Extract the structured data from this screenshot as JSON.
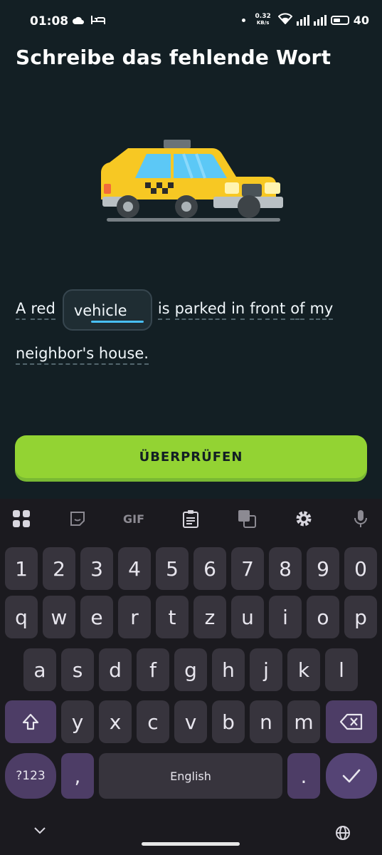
{
  "status_bar": {
    "time": "01:08",
    "speed_value": "0.32",
    "speed_unit": "KB/s",
    "battery_level": "40",
    "icons": [
      "cloud-icon",
      "bed-icon",
      "wifi-icon",
      "signal-icon",
      "signal-icon",
      "battery-icon"
    ]
  },
  "exercise": {
    "title": "Schreibe das fehlende Wort",
    "image": "taxi-illustration",
    "sentence_words_before": [
      "A",
      "red"
    ],
    "blank_value": "vehicle",
    "sentence_words_after_line1": [
      "is",
      "parked",
      "in",
      "front",
      "of",
      "my"
    ],
    "sentence_line2": "neighbor's house.",
    "check_button": "ÜBERPRÜFEN"
  },
  "keyboard": {
    "toolbar": [
      "apps-icon",
      "sticker-icon",
      "gif-label",
      "clipboard-icon",
      "translate-icon",
      "settings-icon",
      "mic-icon"
    ],
    "gif_label": "GIF",
    "row_numbers": [
      "1",
      "2",
      "3",
      "4",
      "5",
      "6",
      "7",
      "8",
      "9",
      "0"
    ],
    "row1": [
      "q",
      "w",
      "e",
      "r",
      "t",
      "z",
      "u",
      "i",
      "o",
      "p"
    ],
    "row2": [
      "a",
      "s",
      "d",
      "f",
      "g",
      "h",
      "j",
      "k",
      "l"
    ],
    "row3": [
      "y",
      "x",
      "c",
      "v",
      "b",
      "n",
      "m"
    ],
    "symbols_key": "?123",
    "comma_key": ",",
    "space_label": "English",
    "period_key": ".",
    "colors": {
      "background": "#1b1a1f",
      "key": "#37343d",
      "special": "#4d3d66"
    }
  },
  "colors": {
    "background": "#131f24",
    "accent_green": "#93d333",
    "blank_underline": "#49c0f8"
  }
}
